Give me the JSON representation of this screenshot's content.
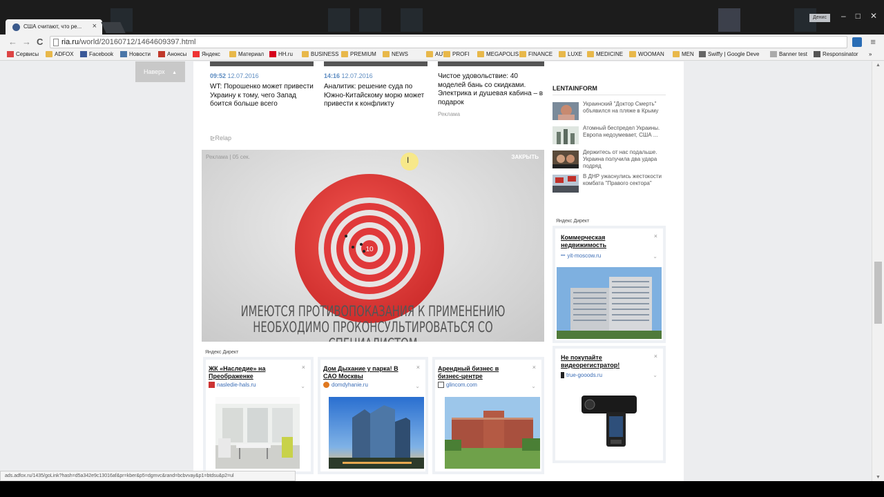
{
  "browser": {
    "tab_title": "США считают, что ре...",
    "tab_close": "×",
    "user_badge": "Денис",
    "url_host": "ria.ru",
    "url_path": "/world/20160712/1464609397.html",
    "nav_back": "←",
    "nav_forward": "→",
    "nav_reload": "C",
    "menu": "≡",
    "win_minimize": "–",
    "win_maximize": "□",
    "win_close": "✕",
    "bookmarks_more": "»",
    "bookmarks": [
      "Сервисы",
      "ADFOX",
      "Facebook",
      "Новости",
      "Анонсы",
      "Яндекс",
      "Материал",
      "HH.ru",
      "BUSINESS",
      "PREMIUM",
      "NEWS",
      "AUTO",
      "PROFI",
      "MEGAPOLIS",
      "FINANCE",
      "LUXE",
      "MEDICINE",
      "WOOMAN",
      "MEN",
      "Swiffy | Google Deve",
      "Banner test",
      "Responsinator"
    ],
    "status_url": "ads.adfox.ru/1435/goLink?hash=d5a342e9c13016af&pr=kber&p5=dgmvc&rand=bcbvvay&p1=btdsu&p2=ul"
  },
  "page": {
    "back_to_top": "Наверх",
    "news": [
      {
        "time": "09:52",
        "date": "12.07.2016",
        "text": "WT: Порошенко может привести Украину к тому, чего Запад боится больше всего"
      },
      {
        "time": "14:16",
        "date": "12.07.2016",
        "text": "Аналитик: решение суда по Южно-Китайскому морю может привести к конфликту"
      },
      {
        "text": "Чистое удовольствие: 40 моделей бань со скидками. Электрика и душевая кабина – в подарок",
        "ad_label": "Реклама"
      }
    ],
    "relap": "Relap",
    "video_ad": {
      "label": "Реклама | 05 сек.",
      "close": "ЗАКРЫТЬ",
      "target_number": "10",
      "warning_line1": "ИМЕЮТСЯ ПРОТИВОПОКАЗАНИЯ К ПРИМЕНЕНИЮ",
      "warning_line2": "НЕОБХОДИМО ПРОКОНСУЛЬТИРОВАТЬСЯ СО СПЕЦИАЛИСТОМ"
    },
    "cursor_glyph": "I",
    "yandex_direct_label": "Яндекс Директ",
    "direct_cards": [
      {
        "title": "ЖК «Наследие» на Преображенке",
        "domain": "nasledie-hals.ru",
        "close": "×",
        "chevron": "⌄"
      },
      {
        "title": "Дом Дыхание у парка! В САО Москвы",
        "domain": "domdyhanie.ru",
        "close": "×",
        "chevron": "⌄"
      },
      {
        "title": "Арендный бизнес в бизнес-центре",
        "domain": "glincom.com",
        "close": "×",
        "chevron": "⌄"
      }
    ]
  },
  "sidebar": {
    "lentainform_title": "LENTAINFORM",
    "lentainform_items": [
      "Украинский \"Доктор Смерть\" объявился на пляже в Крыму",
      "Атомный беспредел Украины. Европа недоумевает, США ...",
      "Держитесь от нас подальше. Украина получила два удара подряд",
      "В ДНР ужаснулись жестокости комбата \"Правого сектора\""
    ],
    "yandex_direct_label": "Яндекс Директ",
    "cards": [
      {
        "title": "Коммерческая недвижимость",
        "domain": "yit-moscow.ru",
        "close": "×",
        "chevron": "⌄"
      },
      {
        "title": "Не покупайте видеорегистратор!",
        "domain": "true-gooods.ru",
        "close": "×",
        "chevron": "⌄"
      }
    ]
  },
  "colors": {
    "link_blue": "#3a6cb5",
    "news_meta": "#5a8ac0",
    "target_red": "#e0393a"
  }
}
